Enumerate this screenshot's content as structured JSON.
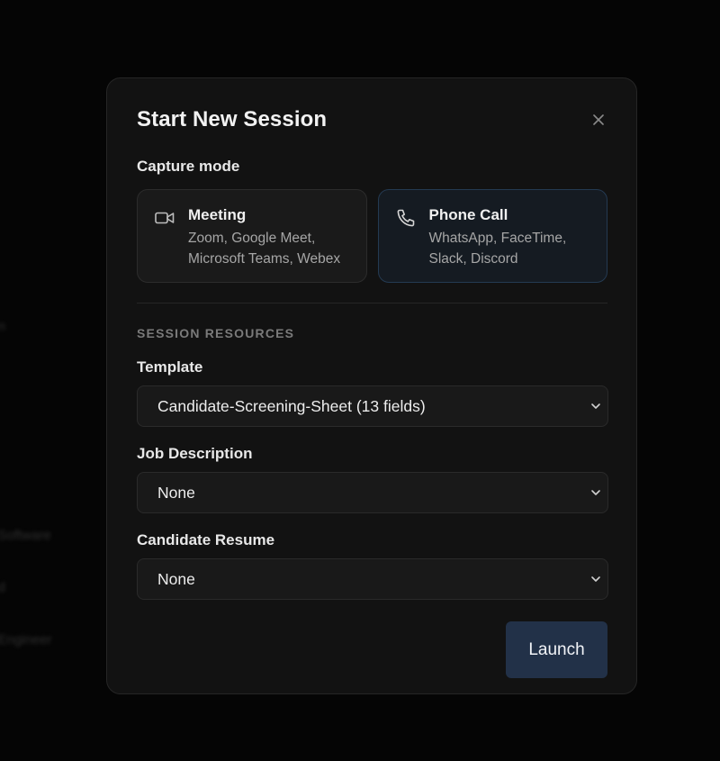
{
  "modal": {
    "title": "Start New Session",
    "close_icon": "close-icon"
  },
  "capture": {
    "label": "Capture mode",
    "modes": [
      {
        "icon": "video-camera-icon",
        "title": "Meeting",
        "desc_line1": "Zoom, Google Meet,",
        "desc_line2": "Microsoft Teams, Webex",
        "selected": false
      },
      {
        "icon": "phone-icon",
        "title": "Phone Call",
        "desc_line1": "WhatsApp, FaceTime,",
        "desc_line2": "Slack, Discord",
        "selected": true
      }
    ]
  },
  "resources": {
    "heading": "SESSION RESOURCES",
    "template": {
      "label": "Template",
      "value": "Candidate-Screening-Sheet (13 fields)"
    },
    "job_description": {
      "label": "Job Description",
      "value": "None"
    },
    "resume": {
      "label": "Candidate Resume",
      "value": "None"
    }
  },
  "actions": {
    "launch_label": "Launch"
  },
  "colors": {
    "accent": "#223148",
    "selected_border": "#243a52"
  }
}
